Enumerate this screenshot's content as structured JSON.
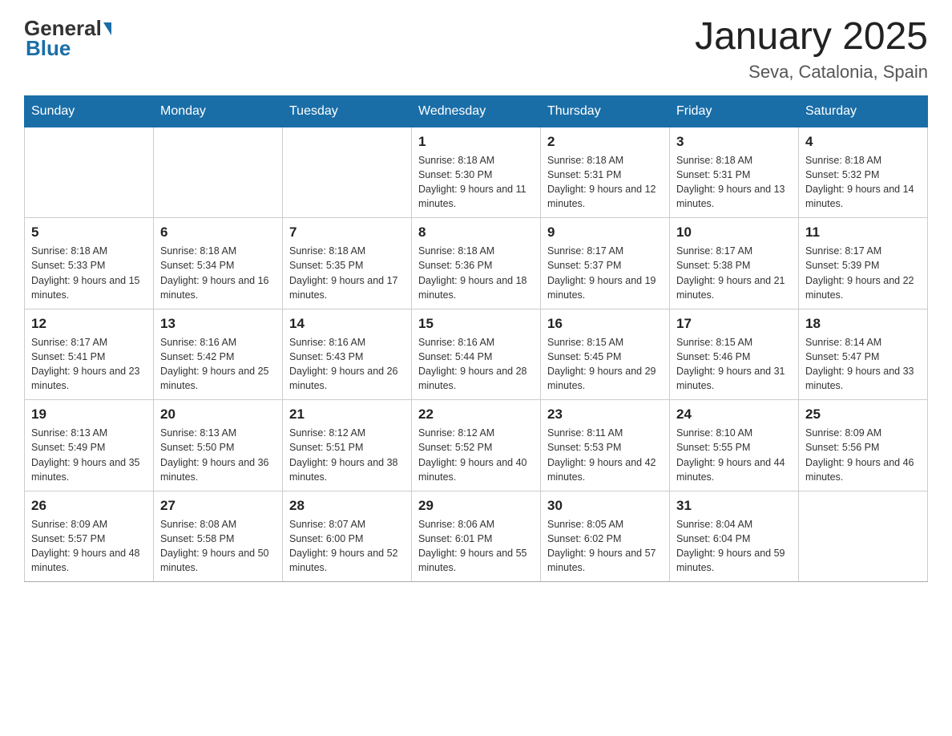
{
  "header": {
    "logo_general": "General",
    "logo_blue": "Blue",
    "month_title": "January 2025",
    "location": "Seva, Catalonia, Spain"
  },
  "weekdays": [
    "Sunday",
    "Monday",
    "Tuesday",
    "Wednesday",
    "Thursday",
    "Friday",
    "Saturday"
  ],
  "weeks": [
    [
      {
        "day": "",
        "info": ""
      },
      {
        "day": "",
        "info": ""
      },
      {
        "day": "",
        "info": ""
      },
      {
        "day": "1",
        "info": "Sunrise: 8:18 AM\nSunset: 5:30 PM\nDaylight: 9 hours and 11 minutes."
      },
      {
        "day": "2",
        "info": "Sunrise: 8:18 AM\nSunset: 5:31 PM\nDaylight: 9 hours and 12 minutes."
      },
      {
        "day": "3",
        "info": "Sunrise: 8:18 AM\nSunset: 5:31 PM\nDaylight: 9 hours and 13 minutes."
      },
      {
        "day": "4",
        "info": "Sunrise: 8:18 AM\nSunset: 5:32 PM\nDaylight: 9 hours and 14 minutes."
      }
    ],
    [
      {
        "day": "5",
        "info": "Sunrise: 8:18 AM\nSunset: 5:33 PM\nDaylight: 9 hours and 15 minutes."
      },
      {
        "day": "6",
        "info": "Sunrise: 8:18 AM\nSunset: 5:34 PM\nDaylight: 9 hours and 16 minutes."
      },
      {
        "day": "7",
        "info": "Sunrise: 8:18 AM\nSunset: 5:35 PM\nDaylight: 9 hours and 17 minutes."
      },
      {
        "day": "8",
        "info": "Sunrise: 8:18 AM\nSunset: 5:36 PM\nDaylight: 9 hours and 18 minutes."
      },
      {
        "day": "9",
        "info": "Sunrise: 8:17 AM\nSunset: 5:37 PM\nDaylight: 9 hours and 19 minutes."
      },
      {
        "day": "10",
        "info": "Sunrise: 8:17 AM\nSunset: 5:38 PM\nDaylight: 9 hours and 21 minutes."
      },
      {
        "day": "11",
        "info": "Sunrise: 8:17 AM\nSunset: 5:39 PM\nDaylight: 9 hours and 22 minutes."
      }
    ],
    [
      {
        "day": "12",
        "info": "Sunrise: 8:17 AM\nSunset: 5:41 PM\nDaylight: 9 hours and 23 minutes."
      },
      {
        "day": "13",
        "info": "Sunrise: 8:16 AM\nSunset: 5:42 PM\nDaylight: 9 hours and 25 minutes."
      },
      {
        "day": "14",
        "info": "Sunrise: 8:16 AM\nSunset: 5:43 PM\nDaylight: 9 hours and 26 minutes."
      },
      {
        "day": "15",
        "info": "Sunrise: 8:16 AM\nSunset: 5:44 PM\nDaylight: 9 hours and 28 minutes."
      },
      {
        "day": "16",
        "info": "Sunrise: 8:15 AM\nSunset: 5:45 PM\nDaylight: 9 hours and 29 minutes."
      },
      {
        "day": "17",
        "info": "Sunrise: 8:15 AM\nSunset: 5:46 PM\nDaylight: 9 hours and 31 minutes."
      },
      {
        "day": "18",
        "info": "Sunrise: 8:14 AM\nSunset: 5:47 PM\nDaylight: 9 hours and 33 minutes."
      }
    ],
    [
      {
        "day": "19",
        "info": "Sunrise: 8:13 AM\nSunset: 5:49 PM\nDaylight: 9 hours and 35 minutes."
      },
      {
        "day": "20",
        "info": "Sunrise: 8:13 AM\nSunset: 5:50 PM\nDaylight: 9 hours and 36 minutes."
      },
      {
        "day": "21",
        "info": "Sunrise: 8:12 AM\nSunset: 5:51 PM\nDaylight: 9 hours and 38 minutes."
      },
      {
        "day": "22",
        "info": "Sunrise: 8:12 AM\nSunset: 5:52 PM\nDaylight: 9 hours and 40 minutes."
      },
      {
        "day": "23",
        "info": "Sunrise: 8:11 AM\nSunset: 5:53 PM\nDaylight: 9 hours and 42 minutes."
      },
      {
        "day": "24",
        "info": "Sunrise: 8:10 AM\nSunset: 5:55 PM\nDaylight: 9 hours and 44 minutes."
      },
      {
        "day": "25",
        "info": "Sunrise: 8:09 AM\nSunset: 5:56 PM\nDaylight: 9 hours and 46 minutes."
      }
    ],
    [
      {
        "day": "26",
        "info": "Sunrise: 8:09 AM\nSunset: 5:57 PM\nDaylight: 9 hours and 48 minutes."
      },
      {
        "day": "27",
        "info": "Sunrise: 8:08 AM\nSunset: 5:58 PM\nDaylight: 9 hours and 50 minutes."
      },
      {
        "day": "28",
        "info": "Sunrise: 8:07 AM\nSunset: 6:00 PM\nDaylight: 9 hours and 52 minutes."
      },
      {
        "day": "29",
        "info": "Sunrise: 8:06 AM\nSunset: 6:01 PM\nDaylight: 9 hours and 55 minutes."
      },
      {
        "day": "30",
        "info": "Sunrise: 8:05 AM\nSunset: 6:02 PM\nDaylight: 9 hours and 57 minutes."
      },
      {
        "day": "31",
        "info": "Sunrise: 8:04 AM\nSunset: 6:04 PM\nDaylight: 9 hours and 59 minutes."
      },
      {
        "day": "",
        "info": ""
      }
    ]
  ]
}
